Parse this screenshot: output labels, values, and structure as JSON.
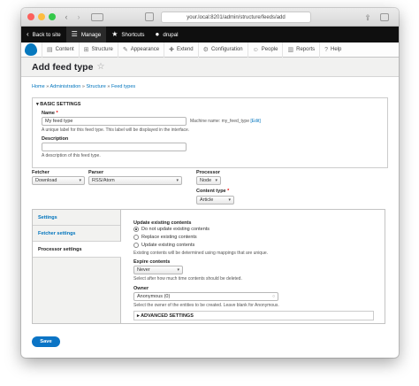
{
  "browser": {
    "url": "your.local:8201/admin/structure/feeds/add"
  },
  "toolbar": {
    "back_label": "Back to site",
    "manage_label": "Manage",
    "shortcuts_label": "Shortcuts",
    "user_label": "drupal"
  },
  "adminmenu": {
    "items": [
      {
        "label": "Content",
        "icon": "file-icon"
      },
      {
        "label": "Structure",
        "icon": "sitemap-icon"
      },
      {
        "label": "Appearance",
        "icon": "paintbrush-icon"
      },
      {
        "label": "Extend",
        "icon": "puzzle-icon"
      },
      {
        "label": "Configuration",
        "icon": "wrench-icon"
      },
      {
        "label": "People",
        "icon": "people-icon"
      },
      {
        "label": "Reports",
        "icon": "bar-chart-icon"
      },
      {
        "label": "Help",
        "icon": "help-icon"
      }
    ]
  },
  "page": {
    "title": "Add feed type",
    "breadcrumb": [
      "Home",
      "Administration",
      "Structure",
      "Feed types"
    ],
    "breadcrumb_sep": "»"
  },
  "basic": {
    "summary": "▾ BASIC SETTINGS",
    "name_label": "Name",
    "name_required": "*",
    "name_value": "My feed type",
    "machine_name_prefix": "Machine name: my_feed_type",
    "machine_name_edit": "[Edit]",
    "name_desc": "A unique label for this feed type. This label will be displayed in the interface.",
    "description_label": "Description",
    "description_value": "",
    "description_desc": "A description of this feed type."
  },
  "plugins": {
    "fetcher_label": "Fetcher",
    "fetcher_value": "Download",
    "parser_label": "Parser",
    "parser_value": "RSS/Atom",
    "processor_label": "Processor",
    "processor_value": "Node",
    "content_type_label": "Content type",
    "content_type_required": "*",
    "content_type_value": "Article"
  },
  "vtabs": {
    "tabs": [
      "Settings",
      "Fetcher settings",
      "Processor settings"
    ],
    "active_tab": "Processor settings",
    "update_label": "Update existing contents",
    "update_options": [
      "Do not update existing contents",
      "Replace existing contents",
      "Update existing contents"
    ],
    "update_selected": "Do not update existing contents",
    "update_desc": "Existing contents will be determined using mappings that are unique.",
    "expire_label": "Expire contents",
    "expire_value": "Never",
    "expire_desc": "Select after how much time contents should be deleted.",
    "owner_label": "Owner",
    "owner_value": "Anonymous (0)",
    "owner_desc": "Select the owner of the entities to be created. Leave blank for Anonymous.",
    "advanced_label": "▸ ADVANCED SETTINGS"
  },
  "actions": {
    "save_label": "Save"
  },
  "colors": {
    "primary": "#0b74c5",
    "link": "#0074bd",
    "toolbar": "#0f0f0f"
  }
}
